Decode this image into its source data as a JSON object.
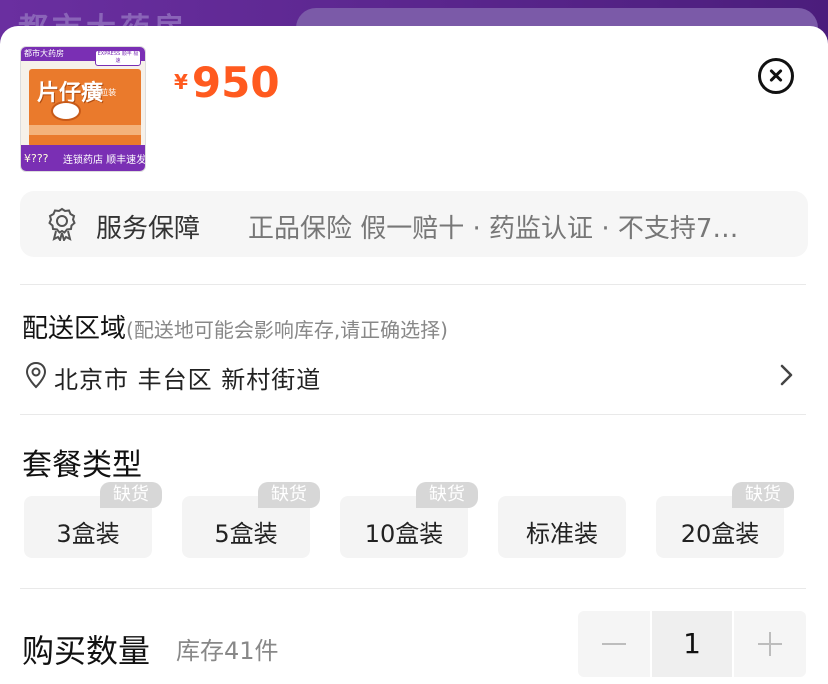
{
  "background": {
    "title": "都市大药房"
  },
  "product": {
    "thumb_store": "都市大药房",
    "thumb_express": "EXPRESS 顺丰 极速",
    "thumb_name": "片仔癀",
    "thumb_sub": "1粒装",
    "thumb_price": "¥???",
    "thumb_tag": "连锁药店 顺丰速发",
    "currency": "¥",
    "price": "950"
  },
  "service": {
    "label": "服务保障",
    "text": "正品保险 假一赔十 · 药监认证 · 不支持7…"
  },
  "delivery": {
    "title": "配送区域",
    "hint": "(配送地可能会影响库存,请正确选择)",
    "location": "北京市 丰台区 新村街道"
  },
  "package": {
    "title": "套餐类型",
    "options": [
      {
        "label": "3盒装",
        "badge": "缺货"
      },
      {
        "label": "5盒装",
        "badge": "缺货"
      },
      {
        "label": "10盒装",
        "badge": "缺货"
      },
      {
        "label": "标准装",
        "badge": ""
      },
      {
        "label": "20盒装",
        "badge": "缺货"
      }
    ]
  },
  "quantity": {
    "title": "购买数量",
    "stock": "库存41件",
    "value": "1"
  },
  "colors": {
    "accent": "#ff5a1f",
    "brand_purple": "#7a2fb4"
  }
}
